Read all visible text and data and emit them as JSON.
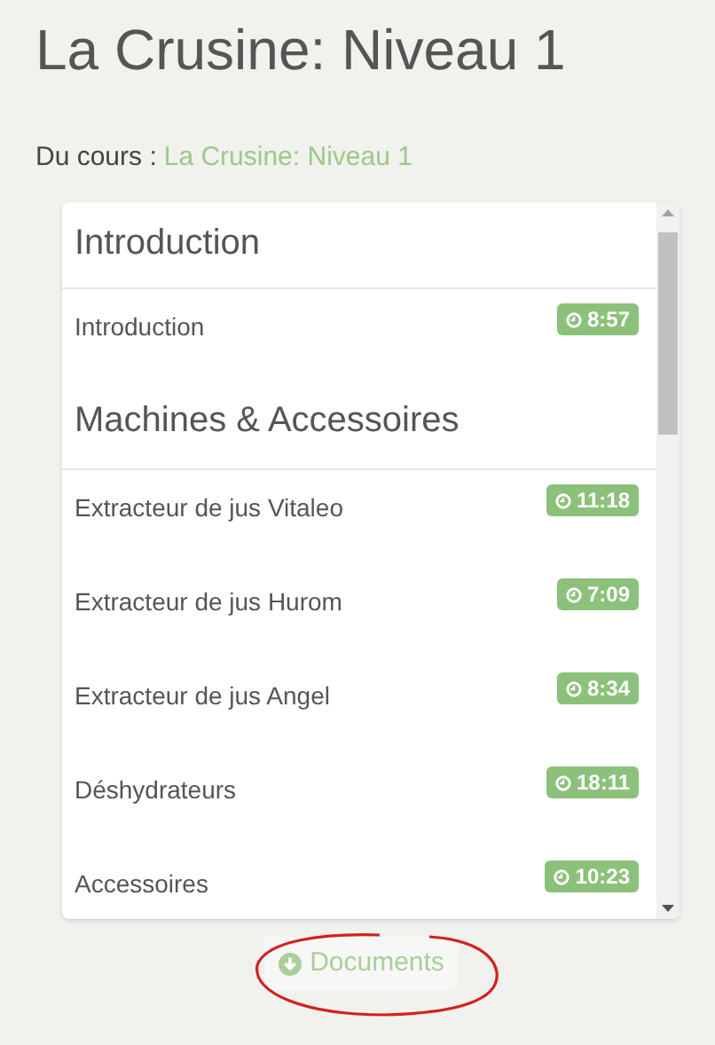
{
  "title": "La Crusine: Niveau 1",
  "course": {
    "label": "Du cours :",
    "link": "La Crusine: Niveau 1"
  },
  "sections": [
    {
      "heading": "Introduction",
      "lessons": [
        {
          "title": "Introduction",
          "duration": "8:57"
        }
      ]
    },
    {
      "heading": "Machines & Accessoires",
      "lessons": [
        {
          "title": "Extracteur de jus Vitaleo",
          "duration": "11:18"
        },
        {
          "title": "Extracteur de jus Hurom",
          "duration": "7:09"
        },
        {
          "title": "Extracteur de jus Angel",
          "duration": "8:34"
        },
        {
          "title": "Déshydrateurs",
          "duration": "18:11"
        },
        {
          "title": "Accessoires",
          "duration": "10:23"
        }
      ]
    }
  ],
  "documents_button": "Documents"
}
